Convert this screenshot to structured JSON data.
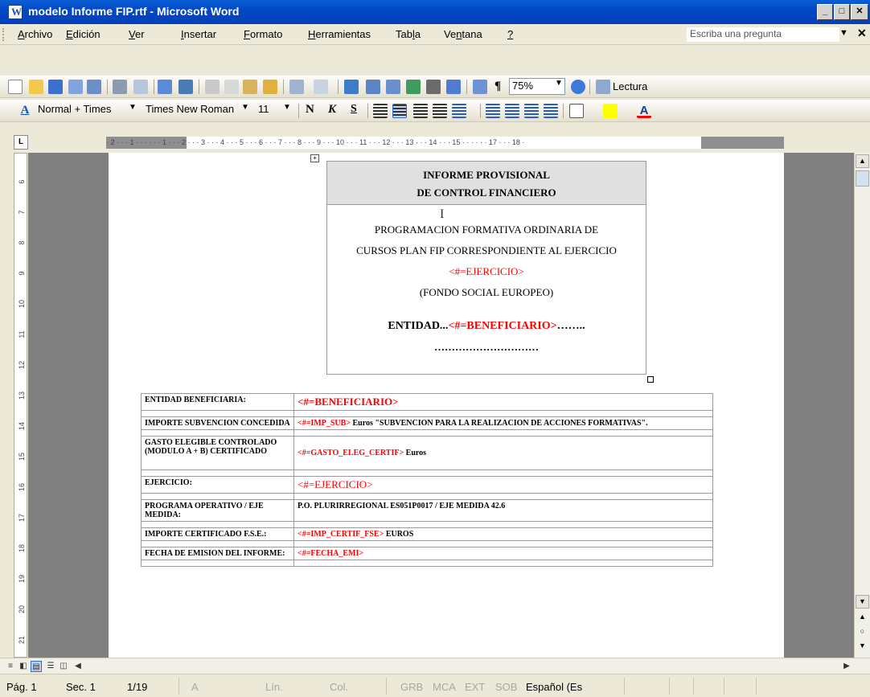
{
  "window": {
    "title": "modelo Informe FIP.rtf - Microsoft Word"
  },
  "menu": {
    "items": [
      {
        "pre": "",
        "ul": "A",
        "post": "rchivo"
      },
      {
        "pre": "",
        "ul": "E",
        "post": "dición"
      },
      {
        "pre": "",
        "ul": "V",
        "post": "er"
      },
      {
        "pre": "",
        "ul": "I",
        "post": "nsertar"
      },
      {
        "pre": "",
        "ul": "F",
        "post": "ormato"
      },
      {
        "pre": "",
        "ul": "H",
        "post": "erramientas"
      },
      {
        "pre": "Tab",
        "ul": "l",
        "post": "a"
      },
      {
        "pre": "Ve",
        "ul": "n",
        "post": "tana"
      },
      {
        "pre": "",
        "ul": "?",
        "post": ""
      }
    ],
    "ask_placeholder": "Escriba una pregunta"
  },
  "toolbar": {
    "zoom": "75%",
    "reading_label": "Lectura",
    "style": "Normal + Times",
    "font": "Times New Roman",
    "size": "11"
  },
  "ruler": {
    "h_labels": "· 2 · · · 1 · · ·   · · · 1 · · · 2 · · · 3 · · · 4 · · · 5 · · · 6 · · · 7 · · · 8 · · · 9 · · · 10 · · · 11 · · · 12 · · · 13 · · · 14 · · · 15 · · ·   · · · 17 · · · 18 ·",
    "v_labels": [
      "6",
      "7",
      "8",
      "9",
      "10",
      "11",
      "12",
      "13",
      "14",
      "15",
      "16",
      "17",
      "18",
      "19",
      "20",
      "21"
    ]
  },
  "document": {
    "title_line1": "INFORME PROVISIONAL",
    "title_line2": "DE CONTROL FINANCIERO",
    "body_line1": "PROGRAMACION FORMATIVA ORDINARIA DE",
    "body_line2": "CURSOS PLAN FIP CORRESPONDIENTE AL EJERCICIO",
    "body_ejercicio": "<#=EJERCICIO>",
    "body_fse": "(FONDO SOCIAL EUROPEO)",
    "entidad_label": "ENTIDAD...",
    "entidad_field": "<#=BENEFICIARIO>",
    "entidad_trail": "……..",
    "dots_line": "…………………………",
    "table": [
      {
        "label": "ENTIDAD BENEFICIARIA:",
        "red": "<#=BENEFICIARIO>",
        "black": ""
      },
      {
        "label": "IMPORTE SUBVENCION CONCEDIDA",
        "red": "<#=IMP_SUB>",
        "black": " Euros \"SUBVENCION PARA LA REALIZACION DE ACCIONES FORMATIVAS\"."
      },
      {
        "label": "GASTO ELEGIBLE CONTROLADO (MODULO A + B) CERTIFICADO",
        "red": "<#=GASTO_ELEG_CERTIF>",
        "black": " Euros"
      },
      {
        "label": "EJERCICIO:",
        "red": "<#=EJERCICIO>",
        "black": ""
      },
      {
        "label": "PROGRAMA OPERATIVO / EJE MEDIDA:",
        "red": "",
        "black": "P.O. PLURIRREGIONAL ES051P0017 / EJE MEDIDA 42.6"
      },
      {
        "label": "IMPORTE CERTIFICADO F.S.E.:",
        "red": "<#=IMP_CERTIF_FSE>",
        "black": " EUROS"
      },
      {
        "label": "FECHA DE EMISION DEL INFORME:",
        "red": "<#=FECHA_EMI>",
        "black": ""
      }
    ]
  },
  "status": {
    "page": "Pág. 1",
    "section": "Sec. 1",
    "pages": "1/19",
    "at": "A",
    "line": "Lín.",
    "col": "Col.",
    "grb": "GRB",
    "mca": "MCA",
    "ext": "EXT",
    "sob": "SOB",
    "language": "Español (Es"
  },
  "colors": {
    "titlebar": "#0348c6",
    "placeholder_red": "#ff0000",
    "desktop_gray": "#808080"
  }
}
